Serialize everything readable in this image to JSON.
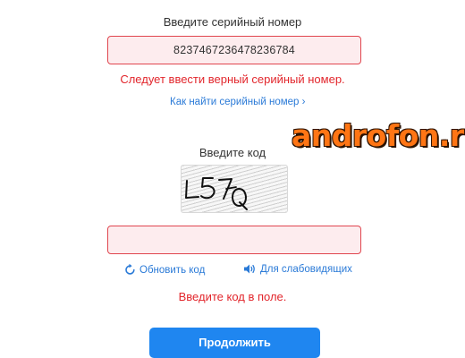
{
  "serial": {
    "label": "Введите серийный номер",
    "value": "8237467236478236784",
    "error": "Следует ввести верный серийный номер.",
    "help_link": "Как найти серийный номер ›"
  },
  "watermark": "androfon.ru",
  "captcha": {
    "label": "Введите код",
    "image_text": "L57Q",
    "input_value": "",
    "refresh_label": "Обновить код",
    "audio_label": "Для слабовидящих",
    "error": "Введите код в поле."
  },
  "continue_button": "Продолжить",
  "colors": {
    "error": "#e2262c",
    "field_bg": "#fdecee",
    "field_border": "#e0464f",
    "link": "#2a7ad7",
    "button": "#1f86f0",
    "watermark": "#ff7514"
  }
}
